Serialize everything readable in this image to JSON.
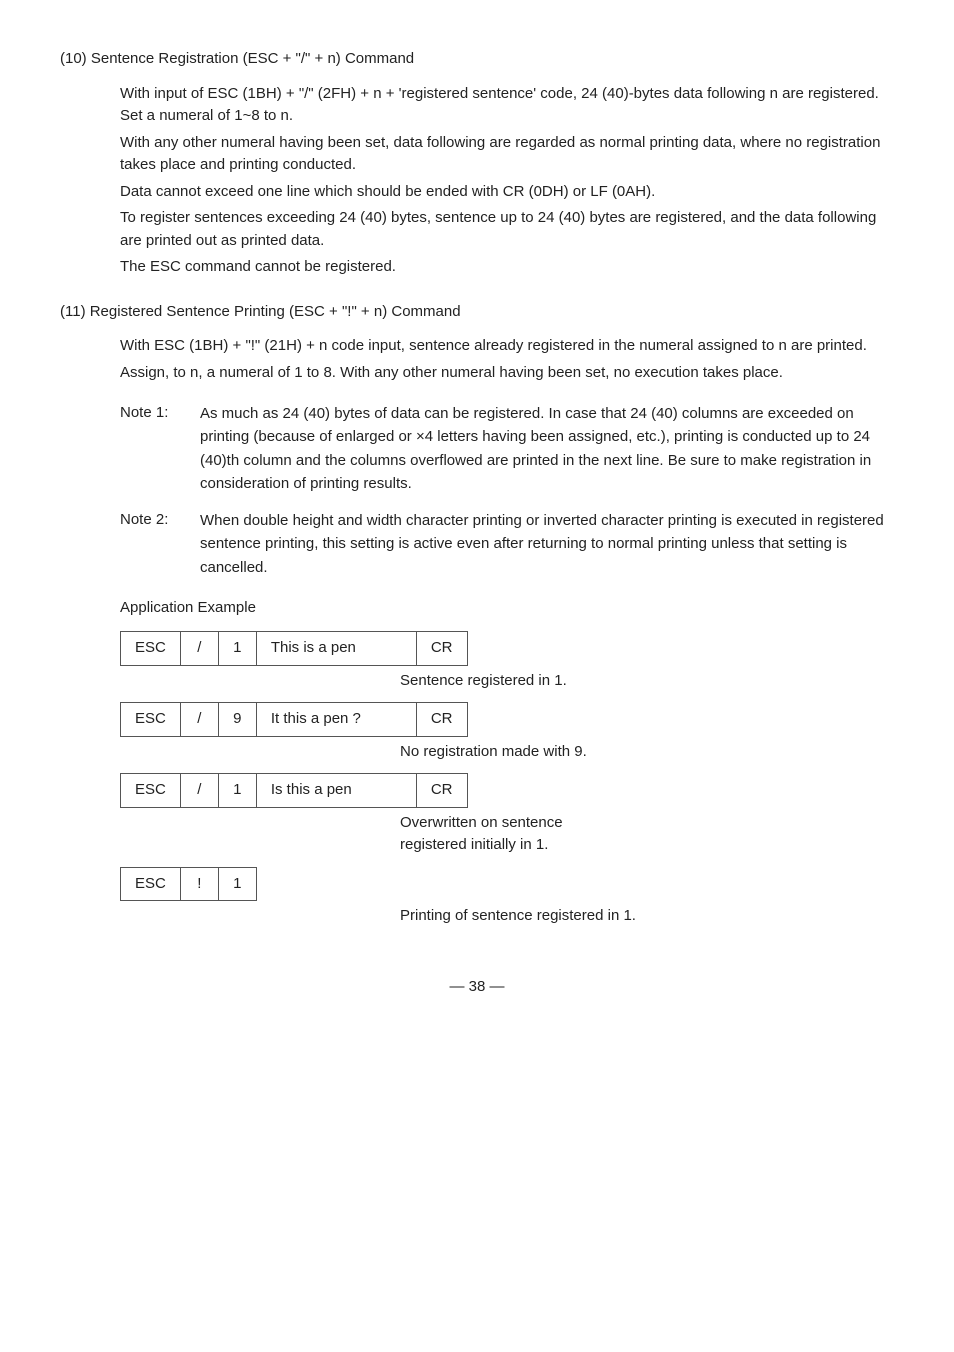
{
  "section10": {
    "title": "(10)  Sentence Registration (ESC + \"/\" + n) Command",
    "body": [
      "With input of ESC (1BH) + \"/\" (2FH) + n + 'registered sentence' code, 24 (40)-bytes data following n are registered.  Set a numeral of 1~8 to n.",
      "With any other numeral having been set, data following are regarded as normal printing data, where no registration takes place and printing conducted.",
      "Data cannot exceed one line which should be ended with CR (0DH) or LF (0AH).",
      "To register sentences exceeding 24 (40) bytes, sentence up to 24 (40) bytes are registered, and the data following are printed out as printed data.",
      "The ESC command cannot be registered."
    ]
  },
  "section11": {
    "title": "(11)  Registered Sentence Printing (ESC + \"!\" + n) Command",
    "body": [
      "With ESC (1BH) + \"!\" (21H) + n code input, sentence already registered in the numeral assigned to n are printed.",
      "Assign, to n, a numeral of 1 to 8.  With any other numeral having been set, no execution takes place."
    ],
    "notes": [
      {
        "label": "Note 1:",
        "text": "As much as 24 (40) bytes of data can be registered.  In case that 24 (40) columns are exceeded on printing (because of enlarged or ×4 letters having been assigned, etc.), printing is conducted up to 24 (40)th column and the columns overflowed are printed in the next line.  Be sure to make registration in consideration of printing results."
      },
      {
        "label": "Note 2:",
        "text": "When double height and width character printing or inverted character printing is executed in registered sentence printing, this setting is active even after returning to normal printing unless that setting is cancelled."
      }
    ]
  },
  "appExample": {
    "title": "Application Example",
    "rows": [
      {
        "cells": [
          "ESC",
          "/",
          "1",
          "This is a pen",
          "",
          "CR"
        ],
        "note": "Sentence registered in 1."
      },
      {
        "cells": [
          "ESC",
          "/",
          "9",
          "It this a pen ?",
          "",
          "CR"
        ],
        "note": "No registration made with 9."
      },
      {
        "cells": [
          "ESC",
          "/",
          "1",
          "Is this a pen",
          "",
          "CR"
        ],
        "note": "Overwritten on sentence\nregistered initially in 1."
      },
      {
        "cells": [
          "ESC",
          "!",
          "1"
        ],
        "note": "Printing of sentence registered in 1."
      }
    ]
  },
  "footer": {
    "text": "— 38 —"
  }
}
